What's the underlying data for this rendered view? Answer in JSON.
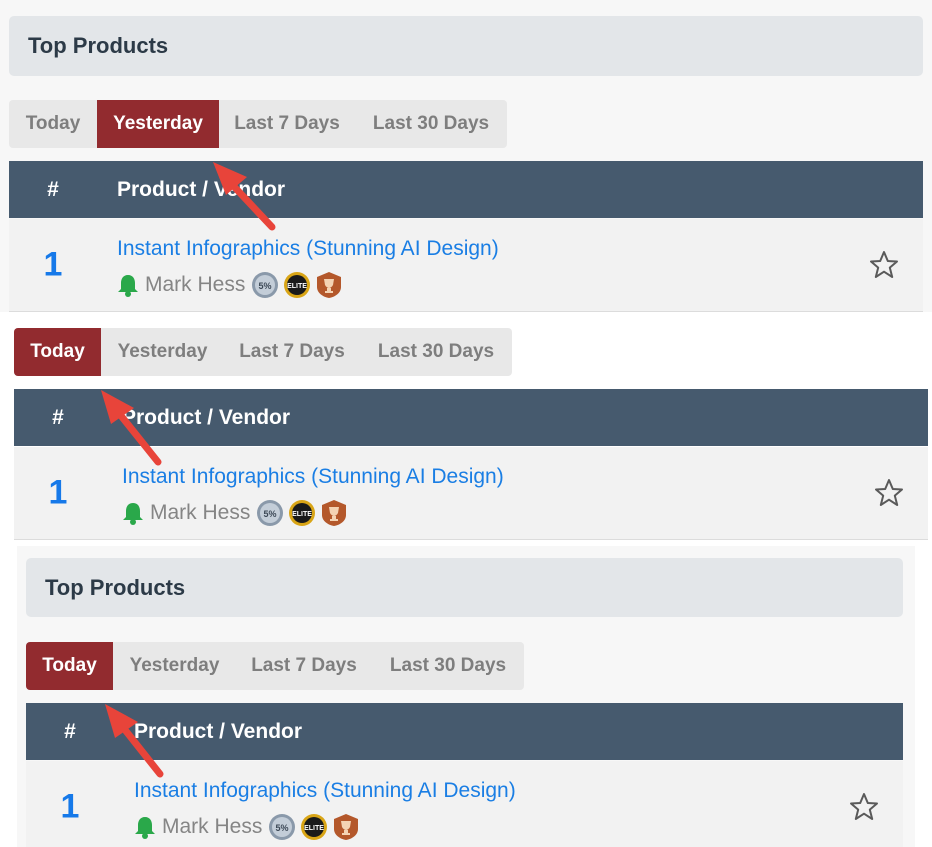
{
  "section": {
    "title": "Top Products"
  },
  "tabs": [
    "Today",
    "Yesterday",
    "Last 7 Days",
    "Last 30 Days"
  ],
  "table": {
    "col_rank": "#",
    "col_product": "Product / Vendor"
  },
  "product": {
    "rank": "1",
    "name": "Instant Infographics (Stunning AI Design)",
    "vendor": "Mark Hess",
    "badges": [
      "5%",
      "ELITE",
      "trophy-icon"
    ]
  },
  "colors": {
    "active_tab": "#922b2f",
    "table_header": "#465a6e",
    "link": "#1a7ee4",
    "rank": "#1679e9",
    "bell": "#2aa84a",
    "arrow": "#e8443a"
  }
}
